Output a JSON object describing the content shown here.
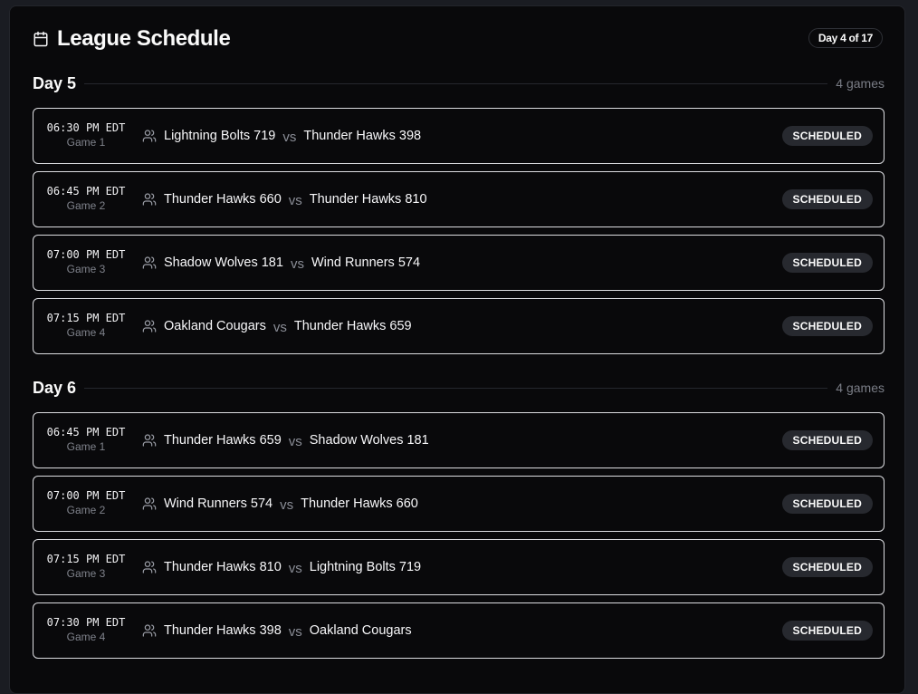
{
  "header": {
    "title": "League Schedule",
    "icon": "calendar-icon",
    "day_badge": "Day 4 of 17"
  },
  "colors": {
    "panel_bg": "#09090b",
    "page_bg": "#1a1c22",
    "row_border": "#dcdde1",
    "badge_bg": "#27292f",
    "muted_text": "#7a7d86"
  },
  "days": [
    {
      "title": "Day 5",
      "count": "4 games",
      "games": [
        {
          "time": "06:30 PM EDT",
          "label": "Game 1",
          "home": "Lightning Bolts 719",
          "vs": "vs",
          "away": "Thunder Hawks 398",
          "status": "SCHEDULED"
        },
        {
          "time": "06:45 PM EDT",
          "label": "Game 2",
          "home": "Thunder Hawks 660",
          "vs": "vs",
          "away": "Thunder Hawks 810",
          "status": "SCHEDULED"
        },
        {
          "time": "07:00 PM EDT",
          "label": "Game 3",
          "home": "Shadow Wolves 181",
          "vs": "vs",
          "away": "Wind Runners 574",
          "status": "SCHEDULED"
        },
        {
          "time": "07:15 PM EDT",
          "label": "Game 4",
          "home": "Oakland Cougars",
          "vs": "vs",
          "away": "Thunder Hawks 659",
          "status": "SCHEDULED"
        }
      ]
    },
    {
      "title": "Day 6",
      "count": "4 games",
      "games": [
        {
          "time": "06:45 PM EDT",
          "label": "Game 1",
          "home": "Thunder Hawks 659",
          "vs": "vs",
          "away": "Shadow Wolves 181",
          "status": "SCHEDULED"
        },
        {
          "time": "07:00 PM EDT",
          "label": "Game 2",
          "home": "Wind Runners 574",
          "vs": "vs",
          "away": "Thunder Hawks 660",
          "status": "SCHEDULED"
        },
        {
          "time": "07:15 PM EDT",
          "label": "Game 3",
          "home": "Thunder Hawks 810",
          "vs": "vs",
          "away": "Lightning Bolts 719",
          "status": "SCHEDULED"
        },
        {
          "time": "07:30 PM EDT",
          "label": "Game 4",
          "home": "Thunder Hawks 398",
          "vs": "vs",
          "away": "Oakland Cougars",
          "status": "SCHEDULED"
        }
      ]
    }
  ]
}
